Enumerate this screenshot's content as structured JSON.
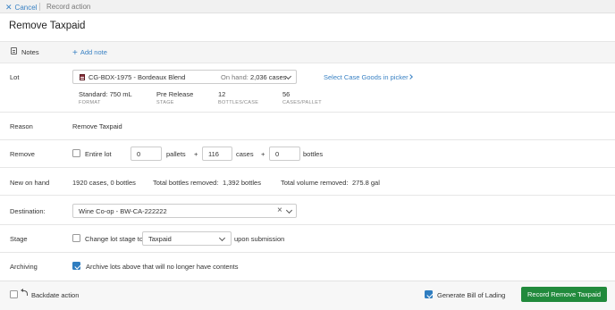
{
  "topbar": {
    "cancel_label": "Cancel",
    "breadcrumb": "Record action"
  },
  "title": "Remove Taxpaid",
  "notes": {
    "label": "Notes",
    "add_label": "Add note"
  },
  "lot": {
    "label": "Lot",
    "name": "CG-BDX-1975 - Bordeaux Blend",
    "on_hand_label": "On hand:",
    "on_hand_value": "2,036 cases",
    "picker_link": "Select Case Goods in picker",
    "attributes": [
      {
        "value": "Standard: 750 mL",
        "caption": "FORMAT"
      },
      {
        "value": "Pre Release",
        "caption": "STAGE"
      },
      {
        "value": "12",
        "caption": "BOTTLES/CASE"
      },
      {
        "value": "56",
        "caption": "CASES/PALLET"
      }
    ]
  },
  "reason": {
    "label": "Reason",
    "value": "Remove Taxpaid"
  },
  "remove": {
    "label": "Remove",
    "entire_lot_label": "Entire lot",
    "entire_lot_checked": false,
    "pallets_value": "0",
    "pallets_label": "pallets",
    "cases_value": "116",
    "cases_label": "cases",
    "bottles_value": "0",
    "bottles_label": "bottles",
    "plus": "+"
  },
  "new_on_hand": {
    "label": "New on hand",
    "value": "1920 cases, 0 bottles",
    "bottles_removed_label": "Total bottles removed:",
    "bottles_removed_value": "1,392 bottles",
    "volume_removed_label": "Total volume removed:",
    "volume_removed_value": "275.8 gal"
  },
  "destination": {
    "label": "Destination:",
    "value": "Wine Co-op - BW-CA-222222"
  },
  "stage": {
    "label": "Stage",
    "change_label": "Change lot stage to",
    "change_checked": false,
    "selected": "Taxpaid",
    "suffix": "upon submission"
  },
  "archiving": {
    "label": "Archiving",
    "checkbox_label": "Archive lots above that will no longer have contents",
    "checked": true
  },
  "footer": {
    "backdate_label": "Backdate action",
    "backdate_checked": false,
    "bol_label": "Generate Bill of Lading",
    "bol_checked": true,
    "submit_label": "Record Remove Taxpaid"
  },
  "colors": {
    "accent": "#3a82c4",
    "primary_button": "#218a3c",
    "lot_icon": "#8b2f3a"
  }
}
